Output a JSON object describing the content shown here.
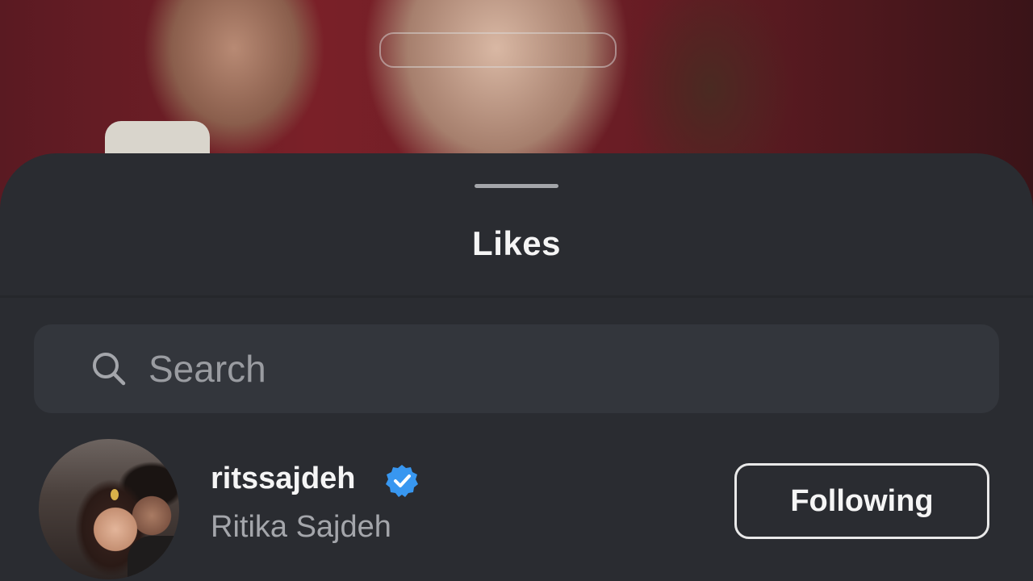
{
  "sheet": {
    "title": "Likes"
  },
  "search": {
    "placeholder": "Search",
    "value": ""
  },
  "users": [
    {
      "username": "ritssajdeh",
      "full_name": "Ritika Sajdeh",
      "verified": true,
      "follow_label": "Following"
    }
  ],
  "icons": {
    "search": "search-icon",
    "verified": "verified-badge-icon",
    "grabber": "drag-handle"
  },
  "colors": {
    "sheet_background": "#2a2c31",
    "search_background": "#33363c",
    "verified_blue": "#3897f0",
    "primary_text": "#f5f5f5",
    "secondary_text": "#a4a6ab"
  }
}
